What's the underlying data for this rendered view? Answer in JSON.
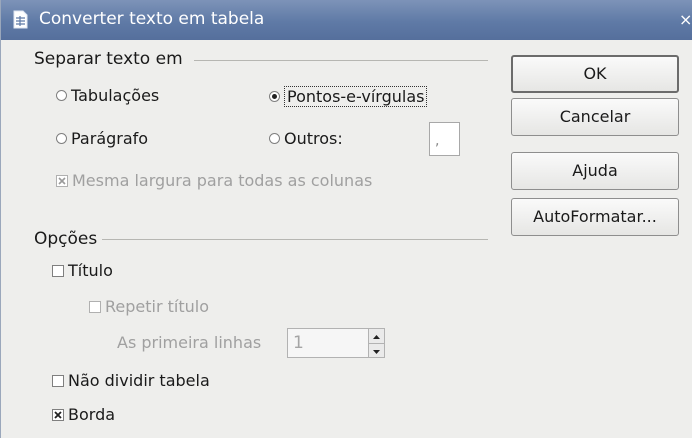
{
  "window": {
    "title": "Converter texto em tabela",
    "close_glyph": "×",
    "icon": "table-document-icon"
  },
  "separate": {
    "title": "Separar texto em",
    "tabs": "Tabulações",
    "semicolons": "Pontos-e-vírgulas",
    "paragraph": "Parágrafo",
    "others": "Outros:",
    "others_value": ",",
    "equal_width": "Mesma largura para todas as colunas"
  },
  "options": {
    "title": "Opções",
    "heading": "Título",
    "repeat_heading": "Repetir título",
    "first_rows": "As primeira linhas",
    "first_rows_value": "1",
    "dont_split": "Não dividir tabela",
    "border": "Borda"
  },
  "buttons": {
    "ok": "OK",
    "cancel": "Cancelar",
    "help": "Ajuda",
    "autoformat": "AutoFormatar..."
  },
  "state": {
    "selected_separator": "semicolons",
    "equal_width_checked": true,
    "equal_width_enabled": false,
    "heading_checked": false,
    "repeat_heading_checked": false,
    "repeat_heading_enabled": false,
    "dont_split_checked": false,
    "border_checked": true
  },
  "colors": {
    "titlebar": "#5f7aa6",
    "dialog_bg": "#eeeeec",
    "disabled_text": "#a0a0a0"
  }
}
